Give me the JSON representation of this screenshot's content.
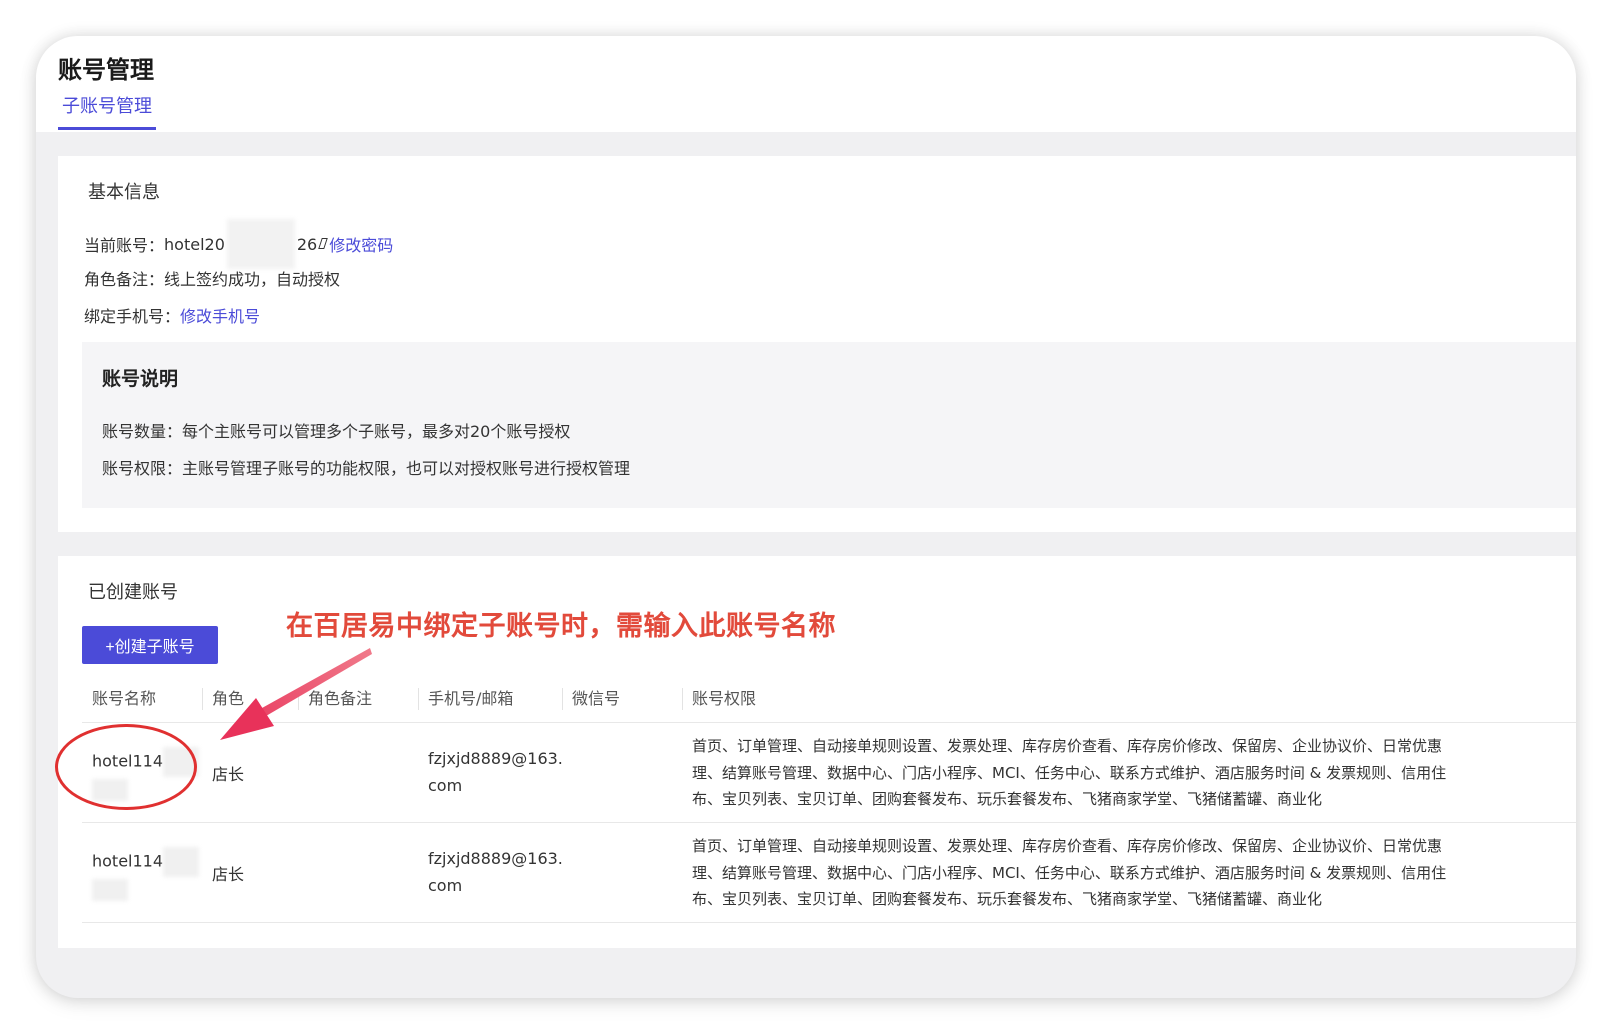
{
  "header": {
    "title": "账号管理",
    "tab": "子账号管理"
  },
  "basic_info": {
    "section_title": "基本信息",
    "current_account_label": "当前账号：",
    "current_account_prefix": "hotel20",
    "current_account_suffix": "26",
    "change_password_link": "修改密码",
    "role_note_label": "角色备注：",
    "role_note_value": "线上签约成功，自动授权",
    "bound_phone_label": "绑定手机号：",
    "change_phone_link": "修改手机号"
  },
  "notice": {
    "title": "账号说明",
    "lines": [
      "账号数量：每个主账号可以管理多个子账号，最多对20个账号授权",
      "账号权限：主账号管理子账号的功能权限，也可以对授权账号进行授权管理"
    ]
  },
  "created_accounts": {
    "section_title": "已创建账号",
    "create_button": "+创建子账号",
    "columns": [
      "账号名称",
      "角色",
      "角色备注",
      "手机号/邮箱",
      "微信号",
      "账号权限"
    ],
    "rows": [
      {
        "name": "hotel114",
        "role": "店长",
        "role_note": "",
        "contact": "fzjxjd8889@163.com",
        "wechat": "",
        "permissions": [
          "首页、订单管理、自动接单规则设置、发票处理、库存房价查看、库存房价修改、保留房、企业协议价、日常优惠",
          "理、结算账号管理、数据中心、门店小程序、MCI、任务中心、联系方式维护、酒店服务时间 & 发票规则、信用住",
          "布、宝贝列表、宝贝订单、团购套餐发布、玩乐套餐发布、飞猪商家学堂、飞猪储蓄罐、商业化"
        ]
      },
      {
        "name": "hotel114",
        "role": "店长",
        "role_note": "",
        "contact": "fzjxjd8889@163.com",
        "wechat": "",
        "permissions": [
          "首页、订单管理、自动接单规则设置、发票处理、库存房价查看、库存房价修改、保留房、企业协议价、日常优惠",
          "理、结算账号管理、数据中心、门店小程序、MCI、任务中心、联系方式维护、酒店服务时间 & 发票规则、信用住",
          "布、宝贝列表、宝贝订单、团购套餐发布、玩乐套餐发布、飞猪商家学堂、飞猪储蓄罐、商业化"
        ]
      }
    ]
  },
  "annotation": {
    "text": "在百居易中绑定子账号时，需输入此账号名称"
  },
  "colors": {
    "accent": "#4b4bd8",
    "annotation": "#e24a3b",
    "ellipse": "#e03030"
  }
}
